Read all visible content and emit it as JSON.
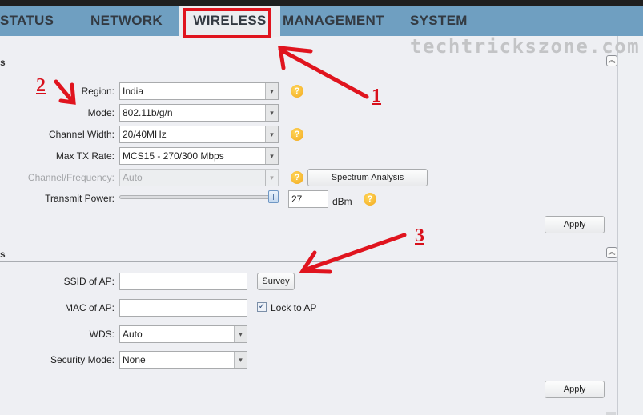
{
  "nav": {
    "tabs": [
      {
        "label": "STATUS",
        "active": false
      },
      {
        "label": "NETWORK",
        "active": false
      },
      {
        "label": "WIRELESS",
        "active": true
      },
      {
        "label": "MANAGEMENT",
        "active": false
      },
      {
        "label": "SYSTEM",
        "active": false
      }
    ]
  },
  "watermark": "techtrickszone.com",
  "colors": {
    "nav_bg": "#6f9fc1",
    "annotation": "#d8101b",
    "help_icon": "#f2a81e"
  },
  "basic_section": {
    "title_fragment": "s",
    "collapse_icon": "double-chevron-up",
    "fields": {
      "region": {
        "label": "Region:",
        "value": "India"
      },
      "mode": {
        "label": "Mode:",
        "value": "802.11b/g/n"
      },
      "channel_width": {
        "label": "Channel Width:",
        "value": "20/40MHz"
      },
      "max_tx_rate": {
        "label": "Max TX Rate:",
        "value": "MCS15 - 270/300 Mbps"
      },
      "channel_frequency": {
        "label": "Channel/Frequency:",
        "value": "Auto",
        "disabled": true
      },
      "transmit_power": {
        "label": "Transmit Power:",
        "value": "27",
        "unit": "dBm",
        "slider_fraction": 1.0
      }
    },
    "spectrum_button": "Spectrum Analysis",
    "apply_button": "Apply",
    "help_glyph": "?"
  },
  "security_section": {
    "title_fragment": "s",
    "collapse_icon": "double-chevron-up",
    "fields": {
      "ssid": {
        "label": "SSID of AP:",
        "value": ""
      },
      "mac": {
        "label": "MAC of AP:",
        "value": ""
      },
      "lock_to_ap": {
        "label": "Lock to AP",
        "checked": true
      },
      "wds": {
        "label": "WDS:",
        "value": "Auto"
      },
      "security_mode": {
        "label": "Security Mode:",
        "value": "None"
      }
    },
    "survey_button": "Survey",
    "apply_button": "Apply"
  },
  "annotations": [
    "1",
    "2",
    "3"
  ],
  "glyphs": {
    "dropdown_arrow": "▾",
    "check": "✓",
    "collapse": "︽"
  }
}
